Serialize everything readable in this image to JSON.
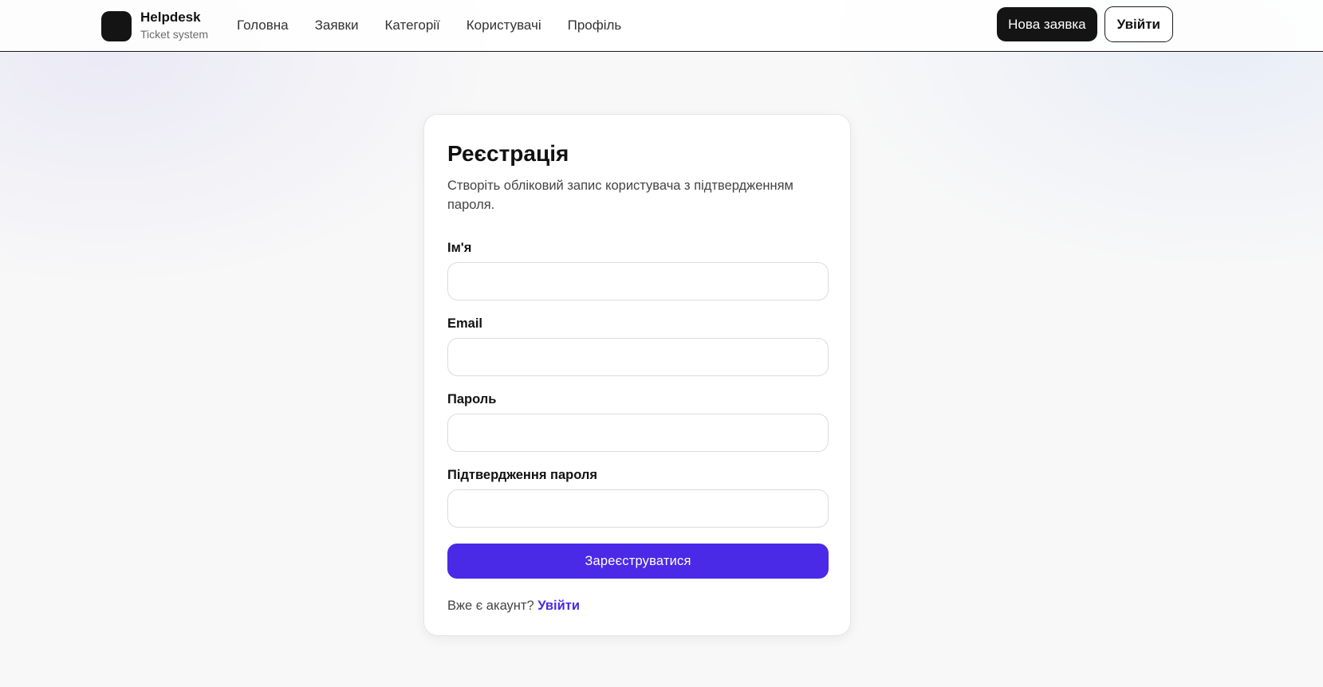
{
  "header": {
    "brand_name": "Helpdesk",
    "brand_subtitle": "Ticket system",
    "nav": [
      {
        "label": "Головна"
      },
      {
        "label": "Заявки"
      },
      {
        "label": "Категорії"
      },
      {
        "label": "Користувачі"
      },
      {
        "label": "Профіль"
      }
    ],
    "new_ticket_label": "Нова заявка",
    "login_label": "Увійти"
  },
  "form": {
    "title": "Реєстрація",
    "description": "Створіть обліковий запис користувача з підтвердженням пароля.",
    "fields": [
      {
        "label": "Ім'я",
        "value": "",
        "placeholder": ""
      },
      {
        "label": "Email",
        "value": "",
        "placeholder": ""
      },
      {
        "label": "Пароль",
        "value": "",
        "placeholder": ""
      },
      {
        "label": "Підтвердження пароля",
        "value": "",
        "placeholder": ""
      }
    ],
    "submit_label": "Зареєструватися",
    "footer_text": "Вже є акаунт?",
    "footer_link": "Увійти"
  },
  "colors": {
    "accent": "#4a2ae6",
    "dark": "#141414",
    "page_bg": "#f8f8f8"
  }
}
